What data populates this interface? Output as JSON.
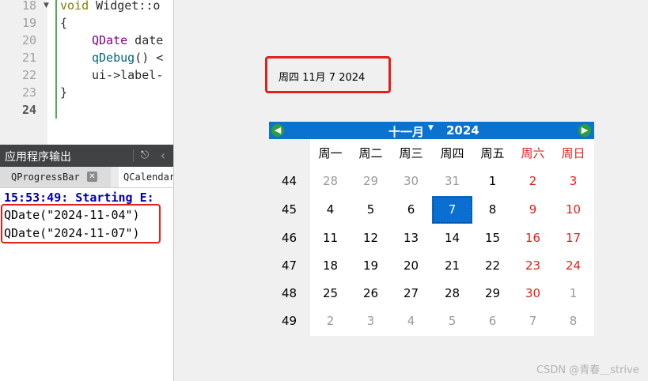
{
  "editor": {
    "line_numbers": [
      "18",
      "19",
      "20",
      "21",
      "22",
      "23",
      "24"
    ],
    "current_line": "24",
    "line18": {
      "kw": "void",
      "rest": " Widget::o"
    },
    "line19": "{",
    "line20": {
      "type": "QDate",
      "rest": " date"
    },
    "line21": {
      "fn": "qDebug",
      "rest": "() <"
    },
    "line22": "ui->label-",
    "line23": "}"
  },
  "output_pane": {
    "title": "应用程序输出",
    "tabs": [
      {
        "label": "QProgressBar",
        "active": false
      },
      {
        "label": "QCalendar",
        "active": true
      }
    ],
    "lines": [
      "15:53:49: Starting E:",
      "QDate(\"2024-11-04\")",
      "QDate(\"2024-11-07\")"
    ]
  },
  "date_label": {
    "text": "周四 11月 7 2024"
  },
  "calendar": {
    "month": "十一月",
    "year": "2024",
    "weekdays": [
      "周一",
      "周二",
      "周三",
      "周四",
      "周五",
      "周六",
      "周日"
    ],
    "weeks": [
      {
        "week": "44",
        "days": [
          "28",
          "29",
          "30",
          "31",
          "1",
          "2",
          "3"
        ]
      },
      {
        "week": "45",
        "days": [
          "4",
          "5",
          "6",
          "7",
          "8",
          "9",
          "10"
        ]
      },
      {
        "week": "46",
        "days": [
          "11",
          "12",
          "13",
          "14",
          "15",
          "16",
          "17"
        ]
      },
      {
        "week": "47",
        "days": [
          "18",
          "19",
          "20",
          "21",
          "22",
          "23",
          "24"
        ]
      },
      {
        "week": "48",
        "days": [
          "25",
          "26",
          "27",
          "28",
          "29",
          "30",
          "1"
        ]
      },
      {
        "week": "49",
        "days": [
          "2",
          "3",
          "4",
          "5",
          "6",
          "7",
          "8"
        ]
      }
    ],
    "selected_day": "7",
    "colors": {
      "header": "#0c72d0",
      "weekend": "#e0201c",
      "selected": "#0a6fd1",
      "other_month": "#9a9a9a"
    }
  },
  "watermark": "CSDN @青春＿strive",
  "colors": {
    "highlight_border": "#e0201c",
    "output_header": "#404244"
  }
}
